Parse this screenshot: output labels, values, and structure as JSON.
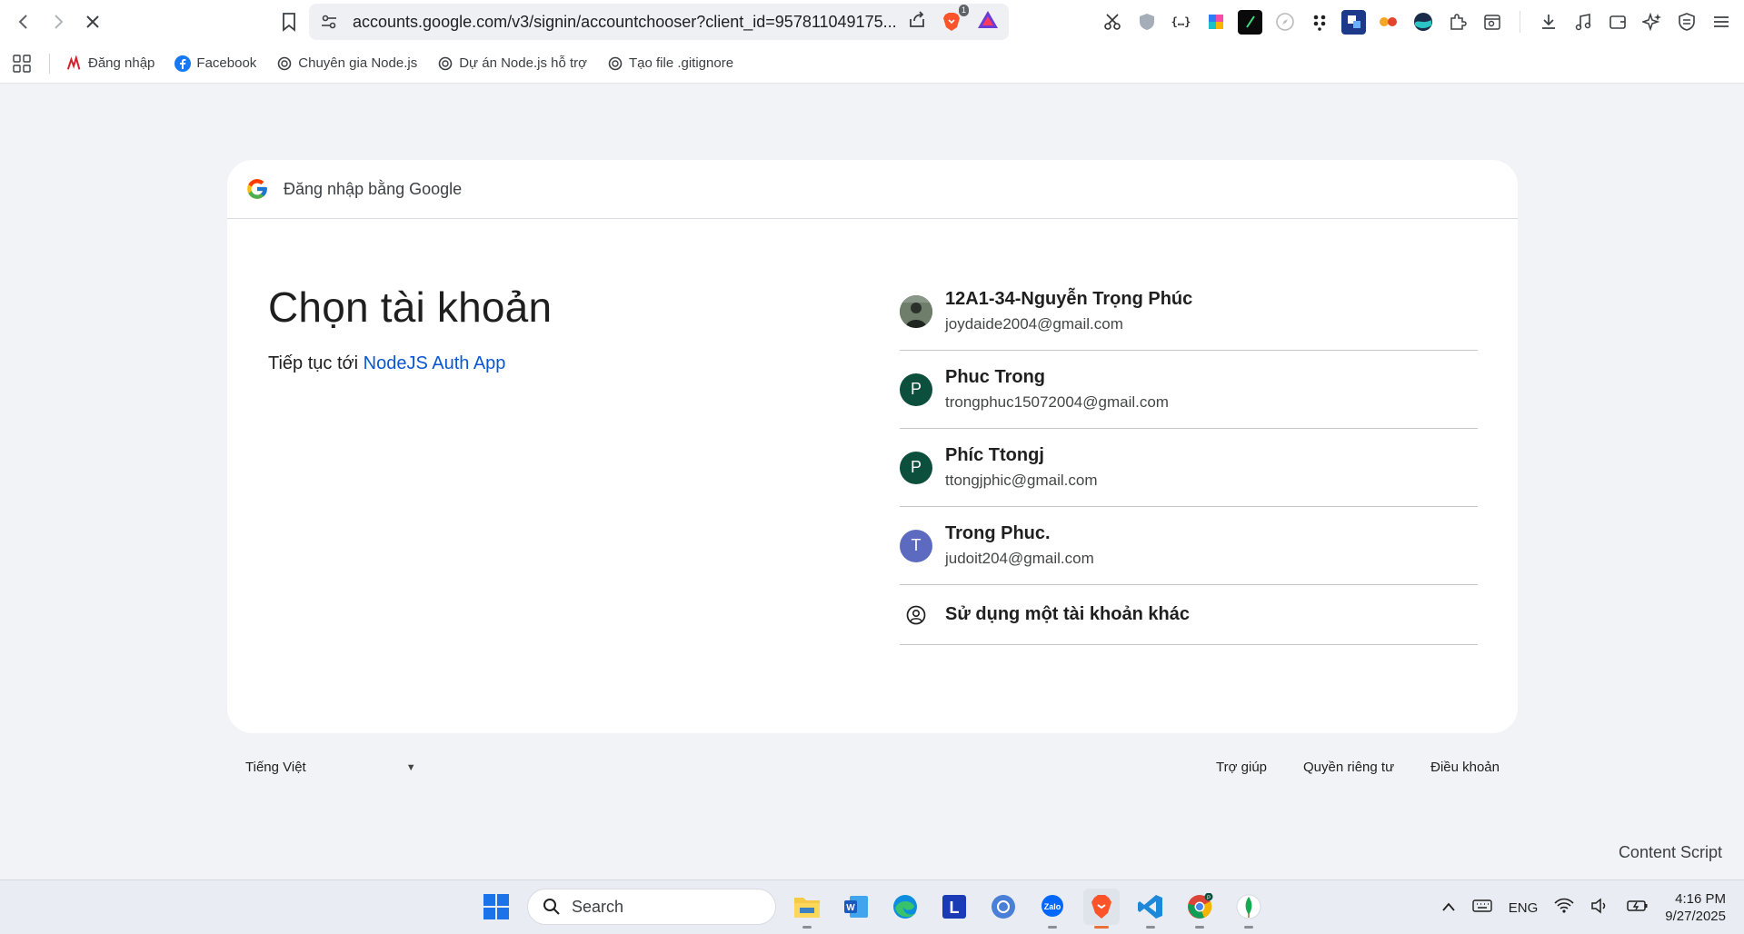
{
  "browser": {
    "url": "accounts.google.com/v3/signin/accountchooser?client_id=957811049175...",
    "brave_badge_count": "1"
  },
  "bookmarks": [
    {
      "label": "Đăng nhập",
      "icon": "red-logo-icon"
    },
    {
      "label": "Facebook",
      "icon": "facebook-icon"
    },
    {
      "label": "Chuyên gia Node.js",
      "icon": "openai-icon"
    },
    {
      "label": "Dự án Node.js hỗ trợ",
      "icon": "openai-icon"
    },
    {
      "label": "Tạo file .gitignore",
      "icon": "openai-icon"
    }
  ],
  "card": {
    "header_text": "Đăng nhập bằng Google",
    "heading": "Chọn tài khoản",
    "continue_prefix": "Tiếp tục tới",
    "app_name": "NodeJS Auth App",
    "accounts": [
      {
        "name": "12A1-34-Nguyễn Trọng Phúc",
        "email": "joydaide2004@gmail.com",
        "initial": "",
        "color": "#3b4a3a"
      },
      {
        "name": "Phuc Trong",
        "email": "trongphuc15072004@gmail.com",
        "initial": "P",
        "color": "#0b4f3c"
      },
      {
        "name": "Phíc Ttongj",
        "email": "ttongjphic@gmail.com",
        "initial": "P",
        "color": "#0b4f3c"
      },
      {
        "name": "Trong Phuc.",
        "email": "judoit204@gmail.com",
        "initial": "T",
        "color": "#5c6bc0"
      }
    ],
    "other_account": "Sử dụng một tài khoản khác"
  },
  "footer": {
    "language": "Tiếng Việt",
    "links": [
      "Trợ giúp",
      "Quyền riêng tư",
      "Điều khoản"
    ]
  },
  "content_script": "Content Script",
  "taskbar": {
    "search": "Search",
    "lang": "ENG",
    "time": "4:16 PM",
    "date": "9/27/2025"
  }
}
